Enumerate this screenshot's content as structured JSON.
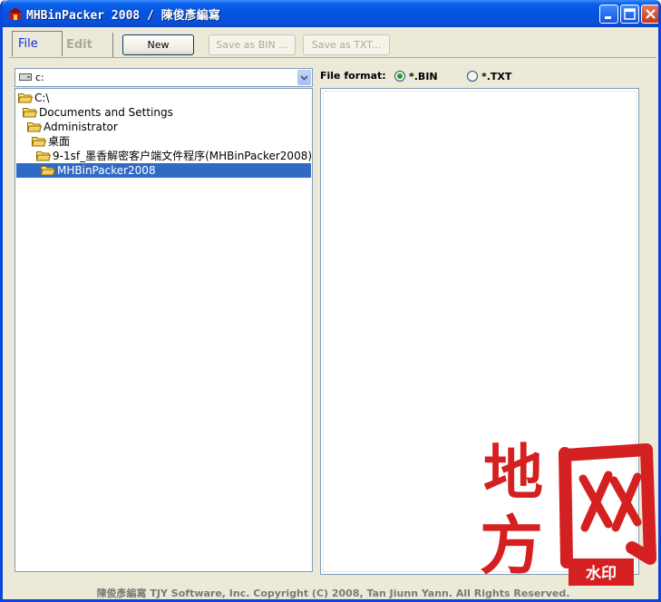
{
  "window": {
    "title": "MHBinPacker 2008 / 陳俊彥編寫"
  },
  "tabs": [
    {
      "label": "File",
      "state": "active"
    },
    {
      "label": "Edit",
      "state": "disabled"
    }
  ],
  "toolbar": {
    "new_label": "New",
    "save_bin_label": "Save as  BIN ...",
    "save_txt_label": "Save as TXT..."
  },
  "drive_select": {
    "value": "c:"
  },
  "tree": {
    "items": [
      {
        "label": "C:\\",
        "level": 0,
        "selected": false
      },
      {
        "label": "Documents and Settings",
        "level": 1,
        "selected": false
      },
      {
        "label": "Administrator",
        "level": 2,
        "selected": false
      },
      {
        "label": "桌面",
        "level": 3,
        "selected": false
      },
      {
        "label": "9-1sf_墨香解密客户端文件程序(MHBinPacker2008)",
        "level": 4,
        "selected": false
      },
      {
        "label": "MHBinPacker2008",
        "level": 5,
        "selected": true
      }
    ]
  },
  "format": {
    "label": "File format:",
    "options": [
      {
        "label": "*.BIN",
        "checked": true
      },
      {
        "label": "*.TXT",
        "checked": false
      }
    ]
  },
  "watermark": {
    "chars": [
      "地",
      "方",
      "网"
    ],
    "badge": "水印"
  },
  "footer": {
    "author": "陳俊彥編寫",
    "text": "TJY Software, Inc.   Copyright (C) 2008, Tan Jiunn Yann. All Rights Reserved."
  },
  "colors": {
    "titlebar": "#0553e0",
    "selection": "#316ac5",
    "watermark": "#d42020"
  }
}
